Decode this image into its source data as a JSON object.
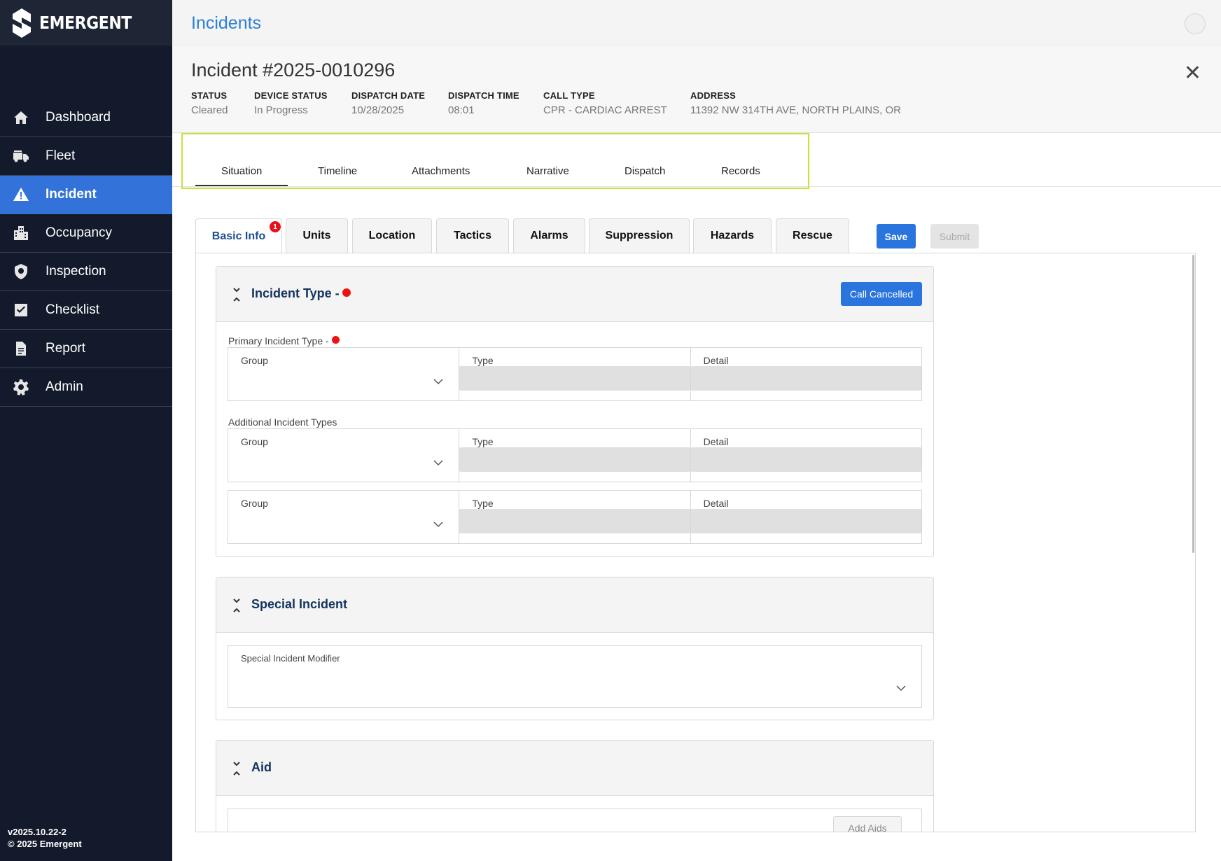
{
  "brand": {
    "name": "EMERGENT"
  },
  "sidebar": {
    "items": [
      {
        "label": "Dashboard",
        "icon": "home-icon",
        "active": false
      },
      {
        "label": "Fleet",
        "icon": "fire-truck-icon",
        "active": false
      },
      {
        "label": "Incident",
        "icon": "warning-icon",
        "active": true
      },
      {
        "label": "Occupancy",
        "icon": "building-icon",
        "active": false
      },
      {
        "label": "Inspection",
        "icon": "shield-search-icon",
        "active": false
      },
      {
        "label": "Checklist",
        "icon": "checkbox-icon",
        "active": false
      },
      {
        "label": "Report",
        "icon": "document-icon",
        "active": false
      },
      {
        "label": "Admin",
        "icon": "gear-icon",
        "active": false
      }
    ],
    "version": "v2025.10.22-2",
    "copyright": "© 2025 Emergent"
  },
  "header": {
    "title": "Incidents"
  },
  "incident": {
    "title": "Incident #2025-0010296",
    "meta": [
      {
        "label": "STATUS",
        "value": "Cleared"
      },
      {
        "label": "DEVICE STATUS",
        "value": "In Progress"
      },
      {
        "label": "DISPATCH DATE",
        "value": "10/28/2025"
      },
      {
        "label": "DISPATCH TIME",
        "value": "08:01"
      },
      {
        "label": "CALL TYPE",
        "value": "CPR - CARDIAC ARREST"
      },
      {
        "label": "ADDRESS",
        "value": "11392 NW 314TH AVE, NORTH PLAINS, OR"
      }
    ]
  },
  "main_tabs": [
    "Situation",
    "Timeline",
    "Attachments",
    "Narrative",
    "Dispatch",
    "Records"
  ],
  "main_tab_active": "Situation",
  "sub_tabs": [
    "Basic Info",
    "Units",
    "Location",
    "Tactics",
    "Alarms",
    "Suppression",
    "Hazards",
    "Rescue"
  ],
  "sub_tab_active": "Basic Info",
  "basic_info_badge": "1",
  "actions": {
    "save": "Save",
    "submit": "Submit"
  },
  "incident_type": {
    "title": "Incident Type -",
    "call_cancelled": "Call Cancelled",
    "primary_label": "Primary Incident Type -",
    "additional_label": "Additional Incident Types",
    "group": "Group",
    "type": "Type",
    "detail": "Detail"
  },
  "special_incident": {
    "title": "Special Incident",
    "modifier_label": "Special Incident Modifier"
  },
  "aid": {
    "title": "Aid",
    "add_button": "Add Aids"
  },
  "colors": {
    "accent": "#2a74de",
    "sidebar_bg": "#131a2b",
    "required": "#ee1111",
    "highlight_box": "#cde03a"
  }
}
